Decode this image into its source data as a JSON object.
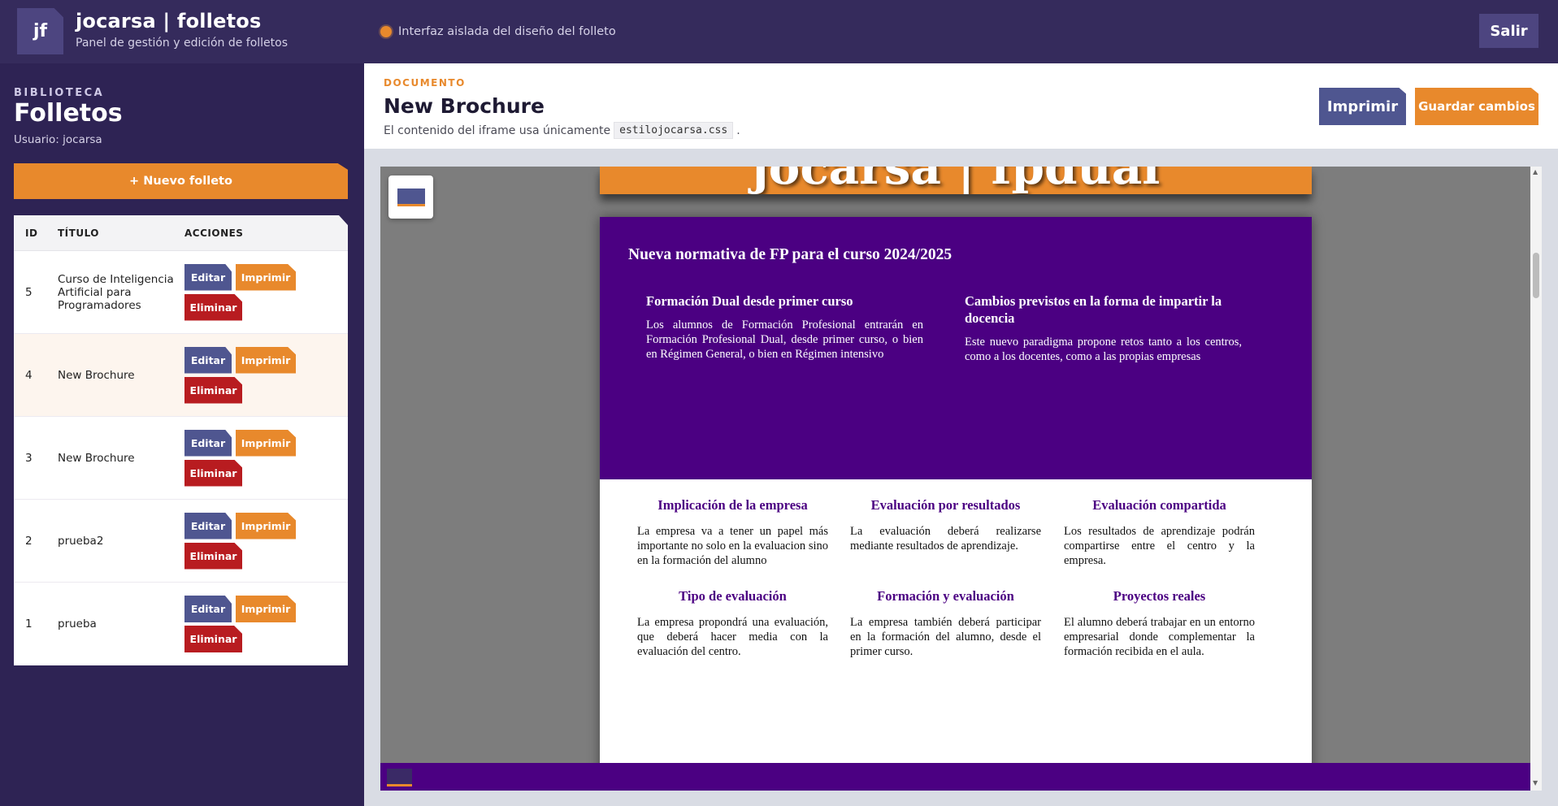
{
  "topbar": {
    "logo_text": "jf",
    "title": "jocarsa | folletos",
    "subtitle": "Panel de gestión y edición de folletos",
    "status_text": "Interfaz aislada del diseño del folleto",
    "logout_label": "Salir"
  },
  "sidebar": {
    "kicker": "BIBLIOTECA",
    "title": "Folletos",
    "user": "Usuario: jocarsa",
    "new_button": "+ Nuevo folleto",
    "columns": {
      "id": "ID",
      "title": "TÍTULO",
      "actions": "ACCIONES"
    },
    "row_actions": {
      "edit": "Editar",
      "print": "Imprimir",
      "delete": "Eliminar"
    },
    "rows": [
      {
        "id": "5",
        "title": "Curso de Inteligencia Artificial para Programadores"
      },
      {
        "id": "4",
        "title": "New Brochure"
      },
      {
        "id": "3",
        "title": "New Brochure"
      },
      {
        "id": "2",
        "title": "prueba2"
      },
      {
        "id": "1",
        "title": "prueba"
      }
    ]
  },
  "document": {
    "kicker": "DOCUMENTO",
    "title": "New Brochure",
    "note_prefix": "El contenido del iframe usa únicamente",
    "note_code": "estilojocarsa.css",
    "note_suffix": ".",
    "print_label": "Imprimir",
    "save_label": "Guardar cambios"
  },
  "brochure": {
    "banner_title": "jocarsa | fpdual",
    "hero_heading": "Nueva normativa de FP para el curso 2024/2025",
    "hero_columns": [
      {
        "title": "Formación Dual desde primer curso",
        "text": "Los alumnos de Formación Profesional entrarán en Formación Profesional Dual, desde primer curso, o bien en Régimen General, o bien en Régimen intensivo"
      },
      {
        "title": "Cambios previstos en la forma de impartir la docencia",
        "text": "Este nuevo paradigma propone retos tanto a los centros, como a los docentes, como a las propias empresas"
      }
    ],
    "features": [
      {
        "title": "Implicación de la empresa",
        "text": "La empresa va a tener un papel más importante no solo en la evaluacion sino en la formación del alumno"
      },
      {
        "title": "Evaluación por resultados",
        "text": "La evaluación deberá realizarse mediante resultados de aprendizaje."
      },
      {
        "title": "Evaluación compartida",
        "text": "Los resultados de aprendizaje podrán compartirse entre el centro y la empresa."
      },
      {
        "title": "Tipo de evaluación",
        "text": "La empresa propondrá una evaluación, que deberá hacer media con la evaluación del centro."
      },
      {
        "title": "Formación y evaluación",
        "text": "La empresa también deberá participar en la formación del alumno, desde el primer curso."
      },
      {
        "title": "Proyectos reales",
        "text": "El alumno deberá trabajar en un entorno empresarial donde complementar la formación recibida en el aula."
      }
    ]
  },
  "colors": {
    "topbar": "#352b5c",
    "sidebar": "#2e2354",
    "accent_orange": "#e8892c",
    "button_blue": "#4f5690",
    "danger_red": "#b81c20",
    "brochure_purple": "#4b0082"
  },
  "icons": {
    "status": "status-dot-icon",
    "preview_toggle": "preview-toggle-icon"
  }
}
